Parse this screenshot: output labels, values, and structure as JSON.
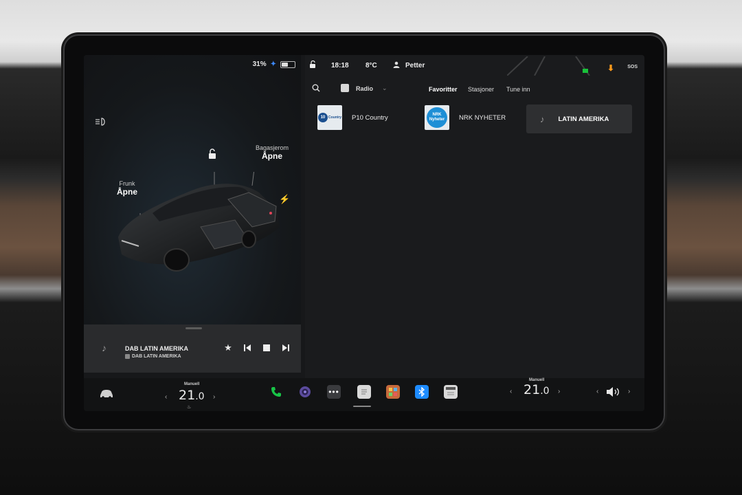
{
  "status_left": {
    "battery": "31%",
    "battery_fraction": 0.5
  },
  "status_top": {
    "time": "18:18",
    "temperature": "8°C",
    "user": "Petter",
    "sos": "SOS"
  },
  "car": {
    "frunk": {
      "label": "Frunk",
      "action": "Åpne"
    },
    "trunk": {
      "label": "Bagasjerom",
      "action": "Åpne"
    }
  },
  "now_playing": {
    "title": "DAB LATIN AMERIKA",
    "subtitle": "DAB LATIN AMERIKA"
  },
  "media": {
    "source": "Radio",
    "tabs": [
      {
        "label": "Favoritter",
        "active": true
      },
      {
        "label": "Stasjoner",
        "active": false
      },
      {
        "label": "Tune inn",
        "active": false
      }
    ],
    "stations": [
      {
        "name": "P10 Country",
        "logo_text": "10 Country",
        "active": false
      },
      {
        "name": "NRK NYHETER",
        "logo_text": "NRK Nyheter",
        "active": false
      },
      {
        "name": "LATIN AMERIKA",
        "logo_text": "",
        "active": true
      }
    ]
  },
  "climate": {
    "left": {
      "mode": "Manuell",
      "temp_int": "21",
      "temp_dec": ".0"
    },
    "right": {
      "mode": "Manuell",
      "temp_int": "21",
      "temp_dec": ".0"
    }
  },
  "colors": {
    "phone": "#18c447",
    "bluetooth": "#1e8cff",
    "accent_green": "#19c13a",
    "download": "#ff9a1b"
  },
  "dock_icons": [
    "car-icon",
    "phone-icon",
    "camera-icon",
    "more-icon",
    "notepad-icon",
    "toybox-icon",
    "bluetooth-icon",
    "calendar-icon",
    "volume-icon"
  ]
}
